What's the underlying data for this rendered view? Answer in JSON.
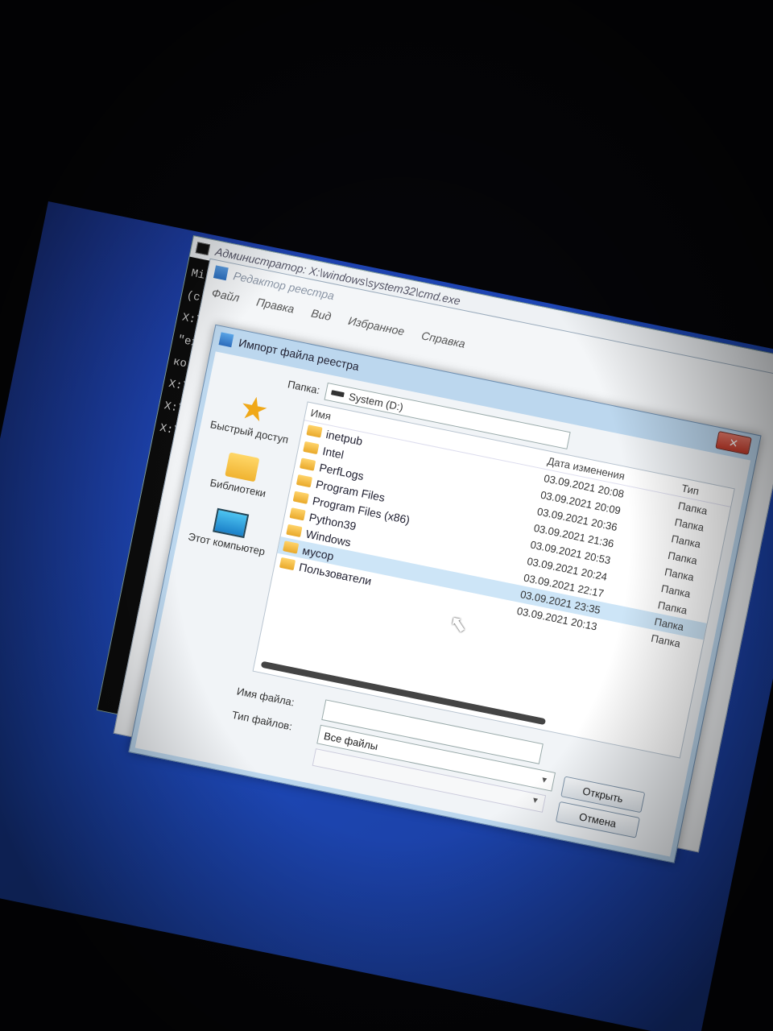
{
  "cmd": {
    "title": "Администратор: X:\\windows\\system32\\cmd.exe",
    "lines": [
      "Mi",
      "(c",
      "X:\\",
      "\"ex",
      "ко",
      "X:\\",
      "X:\\",
      "X:\\"
    ]
  },
  "regedit": {
    "title": "Редактор реестра",
    "menu": [
      "Файл",
      "Правка",
      "Вид",
      "Избранное",
      "Справка"
    ]
  },
  "dialog": {
    "title": "Импорт файла реестра",
    "close_label": "✕",
    "lookin_label": "Папка:",
    "lookin_value": "System (D:)",
    "places": [
      {
        "label": "Быстрый доступ",
        "icon": "star-icon"
      },
      {
        "label": "Библиотеки",
        "icon": "libraries-folder-icon"
      },
      {
        "label": "Этот компьютер",
        "icon": "computer-icon"
      }
    ],
    "columns": {
      "name": "Имя",
      "date": "Дата изменения",
      "type": "Тип"
    },
    "rows": [
      {
        "name": "inetpub",
        "date": "03.09.2021 20:08",
        "type": "Папка"
      },
      {
        "name": "Intel",
        "date": "03.09.2021 20:09",
        "type": "Папка"
      },
      {
        "name": "PerfLogs",
        "date": "03.09.2021 20:36",
        "type": "Папка"
      },
      {
        "name": "Program Files",
        "date": "03.09.2021 21:36",
        "type": "Папка"
      },
      {
        "name": "Program Files (x86)",
        "date": "03.09.2021 20:53",
        "type": "Папка"
      },
      {
        "name": "Python39",
        "date": "03.09.2021 20:24",
        "type": "Папка"
      },
      {
        "name": "Windows",
        "date": "03.09.2021 22:17",
        "type": "Папка"
      },
      {
        "name": "мусор",
        "date": "03.09.2021 23:35",
        "type": "Папка",
        "selected": true
      },
      {
        "name": "Пользователи",
        "date": "03.09.2021 20:13",
        "type": "Папка"
      }
    ],
    "filename_label": "Имя файла:",
    "filename_value": "",
    "filetype_label": "Тип файлов:",
    "filetype_value": "Все файлы",
    "open_button": "Открыть",
    "cancel_button": "Отмена"
  }
}
